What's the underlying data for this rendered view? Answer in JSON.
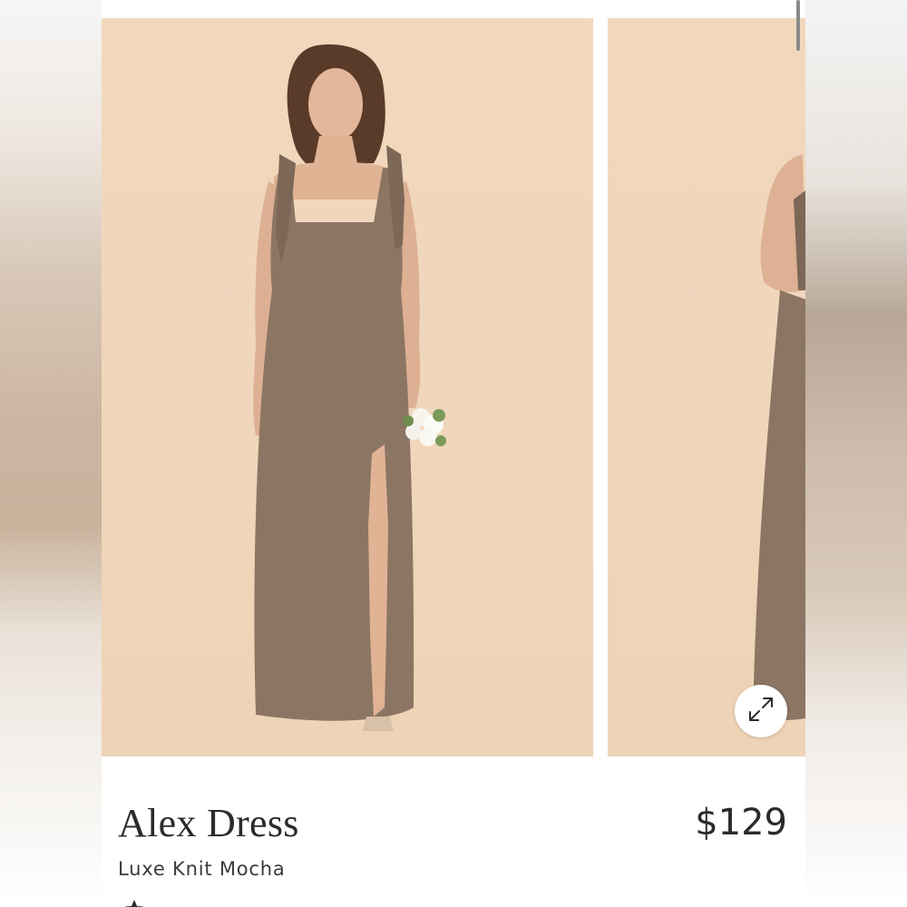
{
  "product": {
    "name": "Alex Dress",
    "variant": "Luxe Knit Mocha",
    "price": "$129"
  },
  "gallery": {
    "image_count_visible": 2,
    "photo_background": "#f0d6bb",
    "dress_color": "#8c7563"
  },
  "icons": {
    "expand": "expand-arrows-icon",
    "rating": "star-icon"
  }
}
